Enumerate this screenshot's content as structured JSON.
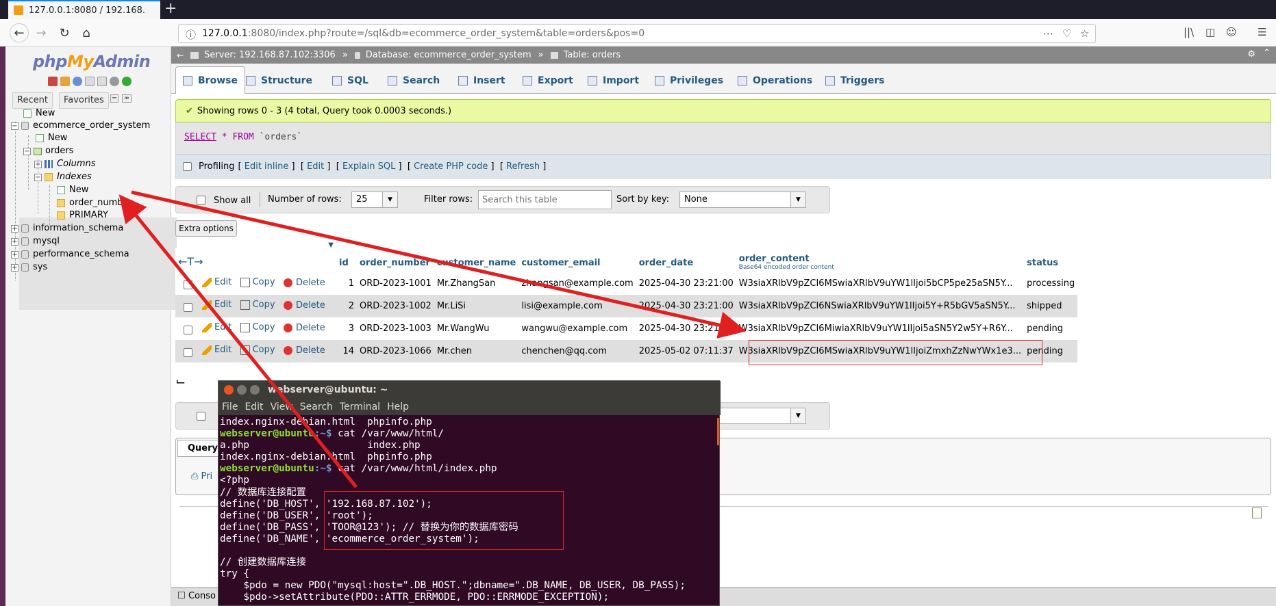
{
  "browser": {
    "tab_title": "127.0.0.1:8080 / 192.168.",
    "new_tab": "+",
    "url_host": "127.0.0.1",
    "url_rest": ":8080/index.php?route=/sql&db=ecommerce_order_system&table=orders&pos=0"
  },
  "nav": {
    "logo_php": "php",
    "logo_my": "My",
    "logo_admin": "Admin",
    "recent": "Recent",
    "favorites": "Favorites",
    "tree": {
      "new_top": "New",
      "db1": "ecommerce_order_system",
      "new_db": "New",
      "table": "orders",
      "columns": "Columns",
      "indexes": "Indexes",
      "new_idx": "New",
      "idx_order_number": "order_number",
      "idx_primary": "PRIMARY",
      "db2": "information_schema",
      "db3": "mysql",
      "db4": "performance_schema",
      "db5": "sys"
    }
  },
  "breadcrumb": {
    "server": "Server: 192.168.87.102:3306",
    "database": "Database: ecommerce_order_system",
    "table": "Table: orders"
  },
  "tabs": {
    "browse": "Browse",
    "structure": "Structure",
    "sql": "SQL",
    "search": "Search",
    "insert": "Insert",
    "export": "Export",
    "import": "Import",
    "privileges": "Privileges",
    "operations": "Operations",
    "triggers": "Triggers"
  },
  "status": {
    "success": "Showing rows 0 - 3 (4 total, Query took 0.0003 seconds.)",
    "sql_select": "SELECT",
    "sql_star": "*",
    "sql_from": "FROM",
    "sql_table": "`orders`",
    "profiling": "Profiling",
    "edit_inline": "Edit inline",
    "edit": "Edit",
    "explain": "Explain SQL",
    "create_php": "Create PHP code",
    "refresh": "Refresh"
  },
  "controls": {
    "show_all": "Show all",
    "num_rows_label": "Number of rows:",
    "num_rows_value": "25",
    "filter_label": "Filter rows:",
    "filter_placeholder": "Search this table",
    "sort_label": "Sort by key:",
    "sort_value": "None",
    "extra_options": "Extra options"
  },
  "table": {
    "columns": {
      "id": "id",
      "order_number": "order_number",
      "customer_name": "customer_name",
      "customer_email": "customer_email",
      "order_date": "order_date",
      "order_content": "order_content",
      "order_content_sub": "Base64 encoded order content",
      "status": "status"
    },
    "action_edit": "Edit",
    "action_copy": "Copy",
    "action_delete": "Delete",
    "rows": [
      {
        "id": "1",
        "order_number": "ORD-2023-1001",
        "customer_name": "Mr.ZhangSan",
        "customer_email": "zhangsan@example.com",
        "order_date": "2025-04-30 23:21:00",
        "order_content": "W3siaXRlbV9pZCI6MSwiaXRlbV9uYW1lIjoi5bCP5pe25aSN5Y...",
        "status": "processing"
      },
      {
        "id": "2",
        "order_number": "ORD-2023-1002",
        "customer_name": "Mr.LiSi",
        "customer_email": "lisi@example.com",
        "order_date": "2025-04-30 23:21:00",
        "order_content": "W3siaXRlbV9pZCI6NSwiaXRlbV9uYW1lIjoi5Y+R5bGV5aSN5Y...",
        "status": "shipped"
      },
      {
        "id": "3",
        "order_number": "ORD-2023-1003",
        "customer_name": "Mr.WangWu",
        "customer_email": "wangwu@example.com",
        "order_date": "2025-04-30 23:21:00",
        "order_content": "W3siaXRlbV9pZCI6MiwiaXRlbV9uYW1lIjoi5aSN5Y2w5Y+R6Y...",
        "status": "pending"
      },
      {
        "id": "14",
        "order_number": "ORD-2023-1066",
        "customer_name": "Mr.chen",
        "customer_email": "chenchen@qq.com",
        "order_date": "2025-05-02 07:11:37",
        "order_content": "W3siaXRlbV9pZCI6MSwiaXRlbV9uYW1lIjoiZmxhZzNwYWx1e3...",
        "status": "pending"
      }
    ]
  },
  "terminal": {
    "title": "webserver@ubuntu: ~",
    "menu": [
      "File",
      "Edit",
      "View",
      "Search",
      "Terminal",
      "Help"
    ],
    "lines": [
      "index.nginx-debian.html  phpinfo.php",
      "cat /var/www/html/",
      "a.php                    index.php",
      "index.nginx-debian.html  phpinfo.php",
      "cat /var/www/html/index.php",
      "<?php",
      "// 数据库连接配置",
      "define('DB_HOST', '192.168.87.102');",
      "define('DB_USER', 'root');",
      "define('DB_PASS', 'TOOR@123'); // 替换为你的数据库密码",
      "define('DB_NAME', 'ecommerce_order_system');",
      "",
      "// 创建数据库连接",
      "try {",
      "    $pdo = new PDO(\"mysql:host=\".DB_HOST.\";dbname=\".DB_NAME, DB_USER, DB_PASS);",
      "    $pdo->setAttribute(PDO::ATTR_ERRMODE, PDO::ERRMODE_EXCEPTION);"
    ],
    "prompt_user": "webserver@ubuntu",
    "prompt_path": ":~$ "
  },
  "bottom": {
    "console": "Conso",
    "query_label": "Query",
    "print_label": "Pri"
  },
  "colors": {
    "annotation": "#e02020",
    "success_bg": "#ebf8a4",
    "terminal_bg": "#300a24"
  }
}
